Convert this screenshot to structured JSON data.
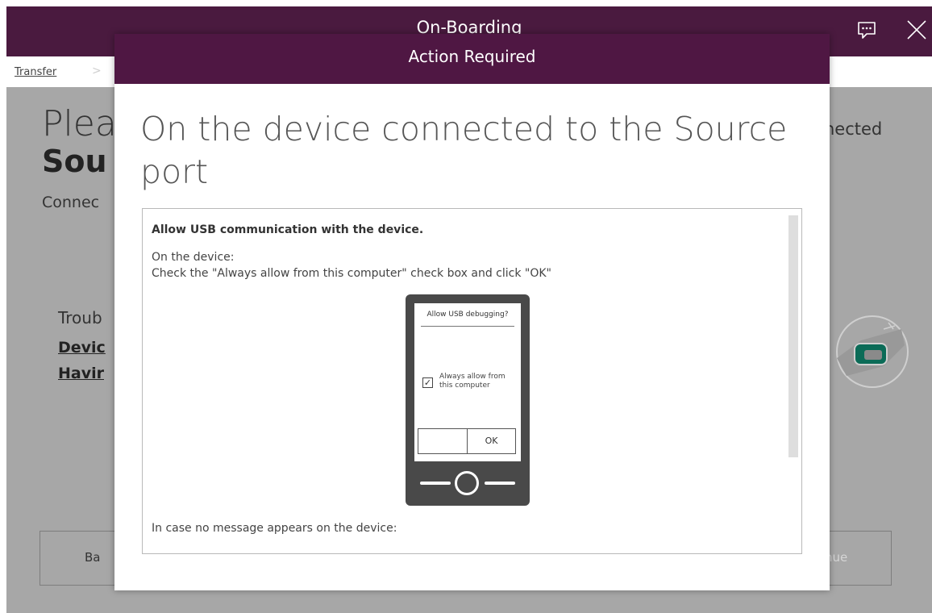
{
  "app": {
    "title": "On-Boarding",
    "breadcrumb": [
      "Transfer"
    ],
    "breadcrumb_separator": ">"
  },
  "background": {
    "heading_partial": "Plea",
    "heading_bold_partial": "Sou",
    "connect_partial": "Connec",
    "trouble_partial": "Troub",
    "link1_partial": "Devic",
    "link2_partial": "Havir",
    "right_partial": "nected",
    "back_partial": "Ba",
    "continue_partial": "nue"
  },
  "modal": {
    "title": "Action Required",
    "heading": "On the device connected to the Source port",
    "instruction_bold": "Allow USB communication with the device.",
    "instruction_line1": "On the device:",
    "instruction_line2": "Check the \"Always allow from this computer\" check box and click \"OK\"",
    "instruction_line3": "In case no message appears on the device:"
  },
  "phone": {
    "dialog_title": "Allow USB debugging?",
    "checkbox_checked": true,
    "checkbox_label": "Always allow from this computer",
    "ok_label": "OK"
  },
  "colors": {
    "titlebar": "#4a1a3f",
    "modal_header": "#4f1743",
    "overlay": "#a7a7a7"
  }
}
